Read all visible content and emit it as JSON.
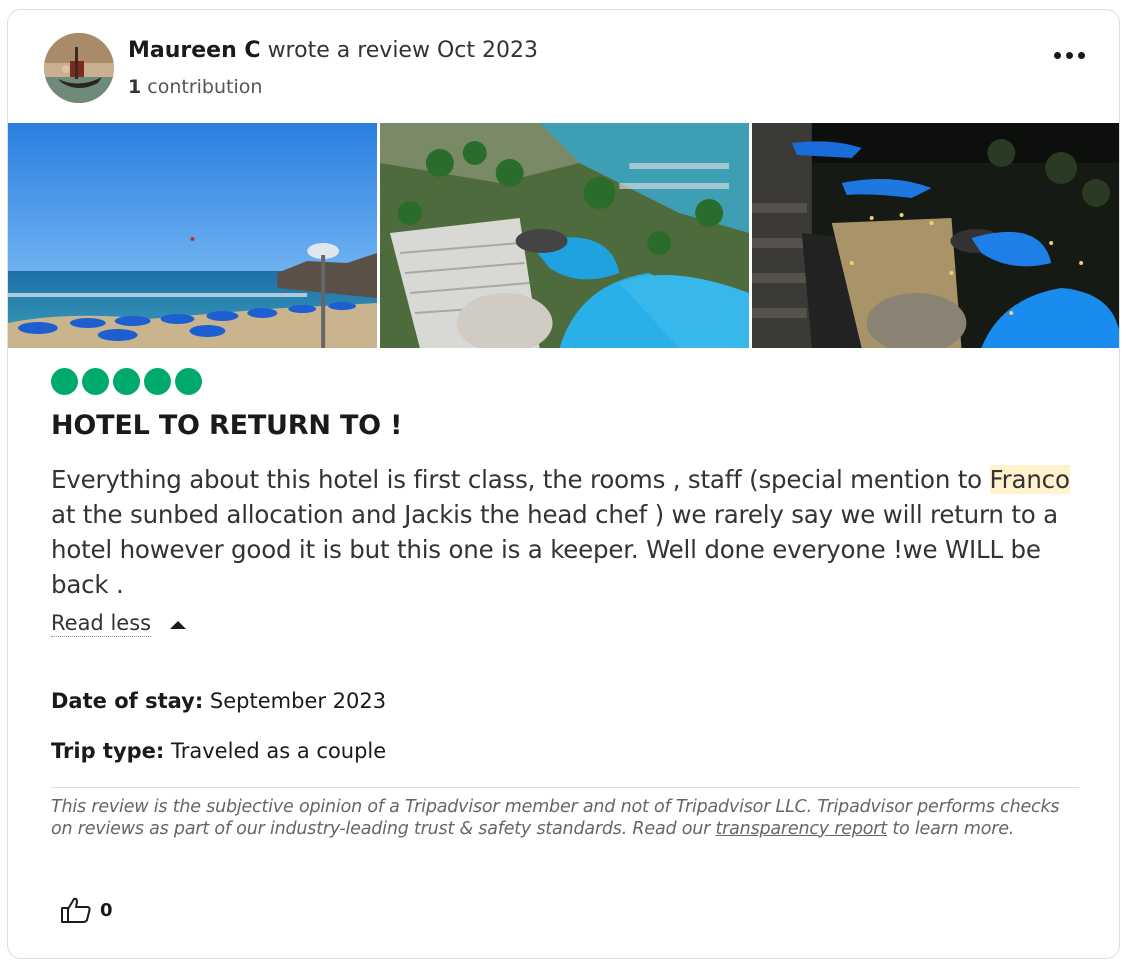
{
  "reviewer": {
    "name": "Maureen C",
    "action": "wrote a review Oct 2023",
    "contribution_count": "1",
    "contribution_label": "contribution"
  },
  "photos": [
    {
      "icon": "beach-photo"
    },
    {
      "icon": "pool-aerial-photo"
    },
    {
      "icon": "pool-night-photo"
    }
  ],
  "rating": {
    "value": 5,
    "max": 5,
    "color": "#00aa6c"
  },
  "review": {
    "title": "HOTEL TO RETURN TO !",
    "body_part1": "Everything about this hotel is first class, the rooms , staff (special mention to ",
    "highlight": "Franco",
    "body_part2": " at the sunbed allocation and Jackis the head chef ) we rarely say we will return to a hotel however good it is but this one is a keeper. Well done everyone !we WILL be back .",
    "read_less_label": "Read less"
  },
  "details": {
    "date_label": "Date of stay:",
    "date_value": "September 2023",
    "trip_label": "Trip type:",
    "trip_value": "Traveled as a couple"
  },
  "disclaimer": {
    "text": "This review is the subjective opinion of a Tripadvisor member and not of Tripadvisor LLC. Tripadvisor performs checks on reviews as part of our industry-leading trust & safety standards. Read our ",
    "link": "transparency report",
    "suffix": " to learn more."
  },
  "helpful": {
    "count": "0"
  },
  "colors": {
    "accent": "#00aa6c",
    "highlight": "#fff2cc"
  }
}
